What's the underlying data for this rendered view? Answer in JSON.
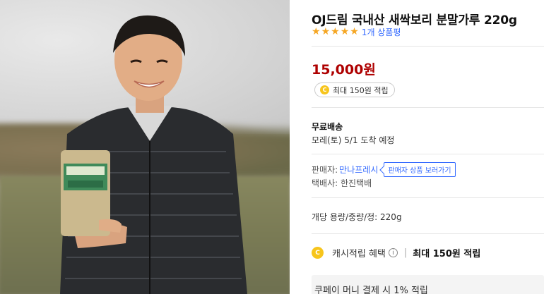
{
  "product": {
    "title": "OJ드림 국내산 새싹보리 분말가루 220g",
    "rating": {
      "stars": 5,
      "review_link": "1개 상품평"
    },
    "price": "15,000원",
    "cash_reward_pill": "최대 150원 적립"
  },
  "shipping": {
    "title": "무료배송",
    "arrival": "모레(토) 5/1 도착 예정"
  },
  "seller": {
    "label": "판매자:",
    "name": "만나프레시",
    "view_button": "판매자 상품 보러가기",
    "courier": "택배사: 한진택배"
  },
  "spec": "개당 용량/중량/정: 220g",
  "cash": {
    "label": "캐시적립 혜택",
    "info_icon": "i",
    "reward": "최대 150원 적립",
    "coin_letter": "C"
  },
  "pay_note": "쿠페이 머니 결제 시 1% 적립",
  "colors": {
    "price": "#ae0000",
    "link": "#346aff",
    "star": "#f5a623",
    "coin": "#f7c51c"
  },
  "icons": [
    "star-icon",
    "coin-icon",
    "info-icon"
  ]
}
